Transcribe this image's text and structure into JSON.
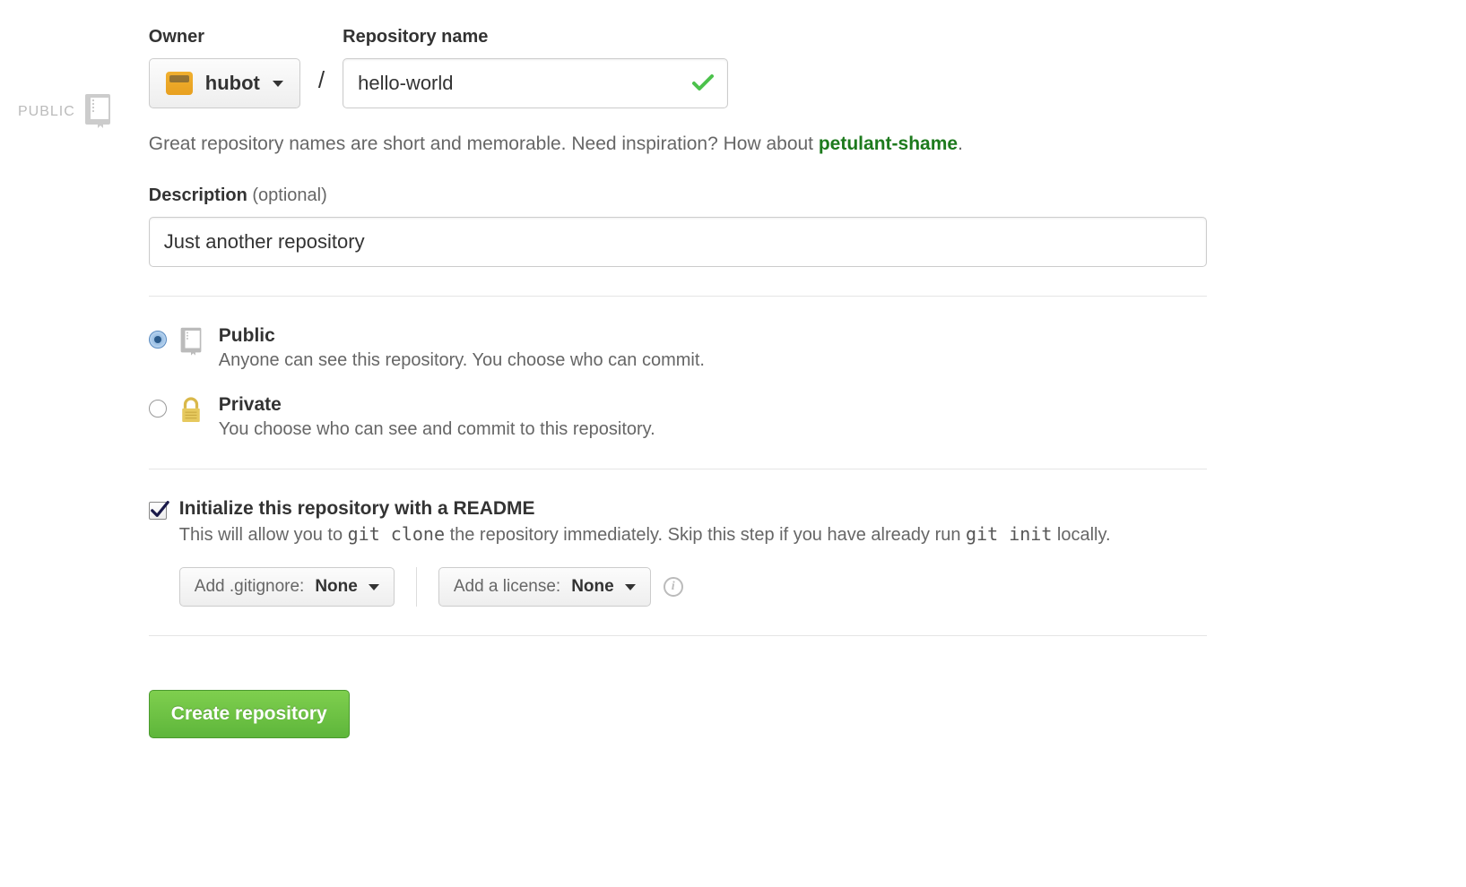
{
  "sidebar": {
    "badge_label": "PUBLIC"
  },
  "owner": {
    "label": "Owner",
    "selected": "hubot"
  },
  "repo_name": {
    "label": "Repository name",
    "value": "hello-world"
  },
  "name_hint": {
    "prefix": "Great repository names are short and memorable. Need inspiration? How about ",
    "suggestion": "petulant-shame",
    "suffix": "."
  },
  "description": {
    "label_bold": "Description",
    "label_optional": " (optional)",
    "value": "Just another repository"
  },
  "visibility": {
    "public": {
      "title": "Public",
      "subtitle": "Anyone can see this repository. You choose who can commit.",
      "selected": true
    },
    "private": {
      "title": "Private",
      "subtitle": "You choose who can see and commit to this repository.",
      "selected": false
    }
  },
  "readme": {
    "title": "Initialize this repository with a README",
    "subtitle_before": "This will allow you to ",
    "code1": "git clone",
    "subtitle_mid": " the repository immediately. Skip this step if you have already run ",
    "code2": "git init",
    "subtitle_after": " locally.",
    "checked": true
  },
  "gitignore": {
    "label": "Add .gitignore: ",
    "value": "None"
  },
  "license": {
    "label": "Add a license: ",
    "value": "None"
  },
  "submit": {
    "label": "Create repository"
  }
}
